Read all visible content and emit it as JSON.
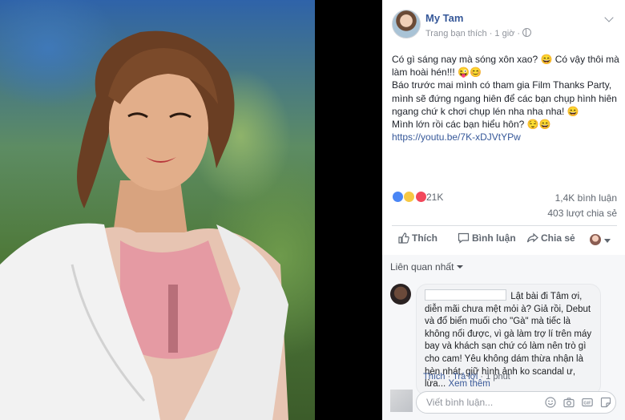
{
  "post": {
    "author": "My Tam",
    "meta": "Trang bạn thích · 1 giờ ·",
    "text_lines": [
      "Có gì sáng nay mà sóng xôn xao? 😄 Có vậy thôi mà làm hoài hén!!! 😜😊",
      "Báo trước mai mình có tham gia Film Thanks Party, mình sẽ đứng ngang hiên để các bạn chụp hình hiên ngang chứ k chơi chụp lén nha nha nha! 😄",
      "Mình lớn rồi các bạn hiểu hôn? 😌😄"
    ],
    "link": "https://youtu.be/7K-xDJVtYPw"
  },
  "stats": {
    "reactions_count": "21K",
    "comments_count": "1,4K bình luận",
    "shares_count": "403 lượt chia sẻ"
  },
  "actions": {
    "like": "Thích",
    "comment": "Bình luận",
    "share": "Chia sẻ"
  },
  "comments": {
    "sort_label": "Liên quan nhất",
    "items": [
      {
        "text": "Lật bài đi Tâm ơi, diễn mãi chưa mệt mỏi à? Giả rồi, Debut và đổ biển muối cho \"Gà\" mà tiếc là không nổi được, vì gà làm trợ lí trên máy bay và khách sạn chứ có làm nên trò gì cho cam! Yêu không dám thừa nhận là hèn nhát, giữ hình ảnh ko scandal ư, lừa...",
        "see_more": "Xem thêm",
        "like": "Thích",
        "reply": "Trả lời",
        "time": "1 phút"
      }
    ],
    "input_placeholder": "Viết bình luận..."
  },
  "colors": {
    "link_blue": "#365899",
    "muted": "#90949c",
    "like_blue": "#4a86f5",
    "love_red": "#f2485b",
    "haha_yellow": "#f7c843"
  }
}
